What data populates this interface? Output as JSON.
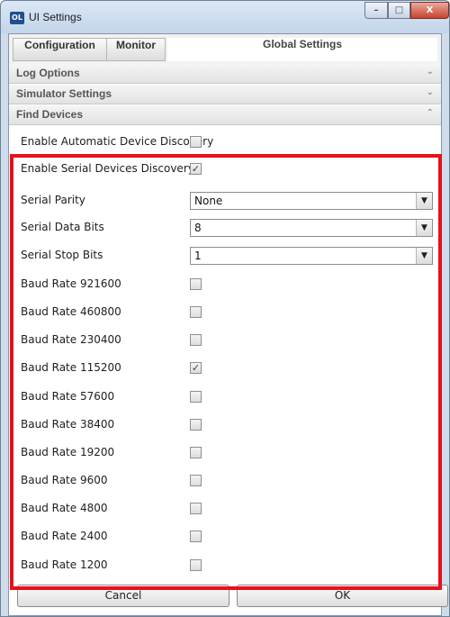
{
  "window": {
    "title": "UI Settings",
    "icon_text": "OL",
    "controls": {
      "minimize": "–",
      "maximize": "□",
      "close": "X"
    }
  },
  "tabs": [
    {
      "label": "Configuration"
    },
    {
      "label": "Monitor"
    },
    {
      "label": "Global Settings",
      "selected": true
    }
  ],
  "sections": {
    "log_options": {
      "label": "Log Options",
      "chevron": "⌄",
      "expanded": false
    },
    "simulator_settings": {
      "label": "Simulator Settings",
      "chevron": "⌄",
      "expanded": false
    },
    "find_devices": {
      "label": "Find Devices",
      "chevron": "⌃",
      "expanded": true
    }
  },
  "find_devices": {
    "auto_discovery": {
      "label": "Enable Automatic Device Discovery",
      "checked": false
    },
    "serial_discovery": {
      "label": "Enable Serial Devices Discovery",
      "checked": true
    },
    "serial_parity": {
      "label": "Serial Parity",
      "value": "None"
    },
    "serial_data_bits": {
      "label": "Serial Data Bits",
      "value": "8"
    },
    "serial_stop_bits": {
      "label": "Serial Stop Bits",
      "value": "1"
    },
    "baud_rates": [
      {
        "label": "Baud Rate 921600",
        "checked": false
      },
      {
        "label": "Baud Rate 460800",
        "checked": false
      },
      {
        "label": "Baud Rate 230400",
        "checked": false
      },
      {
        "label": "Baud Rate 115200",
        "checked": true
      },
      {
        "label": "Baud Rate 57600",
        "checked": false
      },
      {
        "label": "Baud Rate 38400",
        "checked": false
      },
      {
        "label": "Baud Rate 19200",
        "checked": false
      },
      {
        "label": "Baud Rate 9600",
        "checked": false
      },
      {
        "label": "Baud Rate 4800",
        "checked": false
      },
      {
        "label": "Baud Rate 2400",
        "checked": false
      },
      {
        "label": "Baud Rate 1200",
        "checked": false
      }
    ]
  },
  "buttons": {
    "cancel": "Cancel",
    "ok": "OK"
  },
  "colors": {
    "highlight": "#e8101c",
    "check_mark": "#2a3d57"
  },
  "icons": {
    "dropdown": "▼",
    "check": "✓"
  }
}
